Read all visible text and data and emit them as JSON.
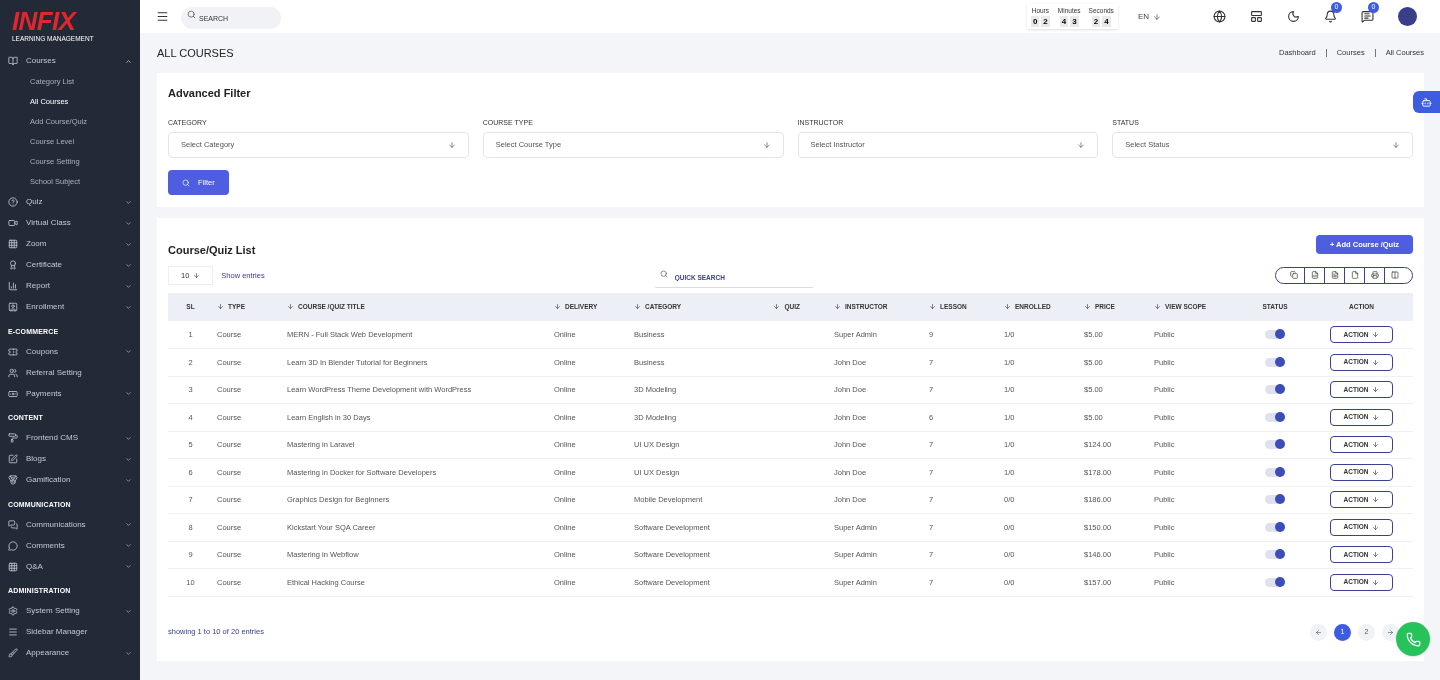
{
  "brand": {
    "logo": "INFIX",
    "tagline": "LEARNING MANAGEMENT"
  },
  "sidebar": {
    "sections": [
      {
        "items": [
          {
            "label": "Courses",
            "expanded": true,
            "children": [
              {
                "label": "Category List",
                "selected": false
              },
              {
                "label": "All Courses",
                "selected": true
              },
              {
                "label": "Add Course/Quiz",
                "selected": false
              },
              {
                "label": "Course Level",
                "selected": false
              },
              {
                "label": "Course Setting",
                "selected": false
              },
              {
                "label": "School Subject",
                "selected": false
              }
            ]
          },
          {
            "label": "Quiz",
            "expanded": false
          },
          {
            "label": "Virtual Class",
            "expanded": false
          },
          {
            "label": "Zoom",
            "expanded": false
          },
          {
            "label": "Certificate",
            "expanded": false
          },
          {
            "label": "Report",
            "expanded": false
          },
          {
            "label": "Enrollment",
            "expanded": false
          }
        ]
      },
      {
        "title": "E-COMMERCE",
        "items": [
          {
            "label": "Coupons",
            "expanded": false
          },
          {
            "label": "Referral Setting"
          },
          {
            "label": "Payments",
            "expanded": false
          }
        ]
      },
      {
        "title": "CONTENT",
        "items": [
          {
            "label": "Frontend CMS",
            "expanded": false
          },
          {
            "label": "Blogs",
            "expanded": false
          },
          {
            "label": "Gamification",
            "expanded": false
          }
        ]
      },
      {
        "title": "COMMUNICATION",
        "items": [
          {
            "label": "Communications",
            "expanded": false
          },
          {
            "label": "Comments",
            "expanded": false
          },
          {
            "label": "Q&A",
            "expanded": false
          }
        ]
      },
      {
        "title": "ADMINISTRATION",
        "items": [
          {
            "label": "System Setting",
            "expanded": false
          },
          {
            "label": "Sidebar Manager"
          },
          {
            "label": "Appearance",
            "expanded": false
          }
        ]
      }
    ]
  },
  "topbar": {
    "search": {
      "placeholder": "SEARCH"
    },
    "timer": [
      {
        "label": "Hours",
        "digits": [
          "0",
          "2"
        ]
      },
      {
        "label": "Minutes",
        "digits": [
          "4",
          "3"
        ]
      },
      {
        "label": "Seconds",
        "digits": [
          "2",
          "4"
        ]
      }
    ],
    "language": "EN",
    "notifications": "0",
    "messages": "0"
  },
  "page": {
    "title": "ALL COURSES",
    "breadcrumb": [
      "Dashboard",
      "Courses",
      "All Courses"
    ]
  },
  "filter": {
    "title": "Advanced Filter",
    "fields": [
      {
        "label": "CATEGORY",
        "placeholder": "Select Category"
      },
      {
        "label": "COURSE TYPE",
        "placeholder": "Select Course Type"
      },
      {
        "label": "INSTRUCTOR",
        "placeholder": "Select Instructor"
      },
      {
        "label": "STATUS",
        "placeholder": "Select Status"
      }
    ],
    "button": "Filter"
  },
  "list": {
    "title": "Course/Quiz List",
    "add_button": "+ Add Course /Quiz",
    "page_size": "10",
    "show_entries": "Show entries",
    "quick_search": {
      "placeholder": "QUICK SEARCH"
    },
    "columns": [
      {
        "label": "SL",
        "sortable": false
      },
      {
        "label": "TYPE",
        "sortable": true
      },
      {
        "label": "COURSE /QUIZ TITLE",
        "sortable": true
      },
      {
        "label": "DELIVERY",
        "sortable": true
      },
      {
        "label": "CATEGORY",
        "sortable": true
      },
      {
        "label": "QUIZ",
        "sortable": true
      },
      {
        "label": "INSTRUCTOR",
        "sortable": true
      },
      {
        "label": "LESSON",
        "sortable": true
      },
      {
        "label": "ENROLLED",
        "sortable": true
      },
      {
        "label": "PRICE",
        "sortable": true
      },
      {
        "label": "VIEW SCOPE",
        "sortable": true
      },
      {
        "label": "STATUS",
        "sortable": false
      },
      {
        "label": "ACTION",
        "sortable": false
      }
    ],
    "rows": [
      {
        "sl": "1",
        "type": "Course",
        "title": "MERN - Full Stack Web Development",
        "delivery": "Online",
        "category": "Business",
        "instructor": "Super Admin",
        "lesson": "9",
        "enrolled": "1/0",
        "price": "$5.00",
        "scope": "Public",
        "status": true,
        "action": "ACTION"
      },
      {
        "sl": "2",
        "type": "Course",
        "title": "Learn 3D In Blender Tutorial for Beginners",
        "delivery": "Online",
        "category": "Business",
        "instructor": "John Doe",
        "lesson": "7",
        "enrolled": "1/0",
        "price": "$5.00",
        "scope": "Public",
        "status": true,
        "action": "ACTION"
      },
      {
        "sl": "3",
        "type": "Course",
        "title": "Learn WordPress Theme Development with WordPress",
        "delivery": "Online",
        "category": "3D Modeling",
        "instructor": "John Doe",
        "lesson": "7",
        "enrolled": "1/0",
        "price": "$5.00",
        "scope": "Public",
        "status": true,
        "action": "ACTION"
      },
      {
        "sl": "4",
        "type": "Course",
        "title": "Learn English in 30 Days",
        "delivery": "Online",
        "category": "3D Modeling",
        "instructor": "John Doe",
        "lesson": "6",
        "enrolled": "1/0",
        "price": "$5.00",
        "scope": "Public",
        "status": true,
        "action": "ACTION"
      },
      {
        "sl": "5",
        "type": "Course",
        "title": "Mastering in Laravel",
        "delivery": "Online",
        "category": "UI UX Design",
        "instructor": "John Doe",
        "lesson": "7",
        "enrolled": "1/0",
        "price": "$124.00",
        "scope": "Public",
        "status": true,
        "action": "ACTION"
      },
      {
        "sl": "6",
        "type": "Course",
        "title": "Mastering in Docker for Software Developers",
        "delivery": "Online",
        "category": "UI UX Design",
        "instructor": "John Doe",
        "lesson": "7",
        "enrolled": "1/0",
        "price": "$178.00",
        "scope": "Public",
        "status": true,
        "action": "ACTION"
      },
      {
        "sl": "7",
        "type": "Course",
        "title": "Graphics Design for Beginners",
        "delivery": "Online",
        "category": "Mobile Development",
        "instructor": "John Doe",
        "lesson": "7",
        "enrolled": "0/0",
        "price": "$186.00",
        "scope": "Public",
        "status": true,
        "action": "ACTION"
      },
      {
        "sl": "8",
        "type": "Course",
        "title": "Kickstart Your SQA Career",
        "delivery": "Online",
        "category": "Software Development",
        "instructor": "Super Admin",
        "lesson": "7",
        "enrolled": "0/0",
        "price": "$150.00",
        "scope": "Public",
        "status": true,
        "action": "ACTION"
      },
      {
        "sl": "9",
        "type": "Course",
        "title": "Mastering in Webflow",
        "delivery": "Online",
        "category": "Software Development",
        "instructor": "Super Admin",
        "lesson": "7",
        "enrolled": "0/0",
        "price": "$146.00",
        "scope": "Public",
        "status": true,
        "action": "ACTION"
      },
      {
        "sl": "10",
        "type": "Course",
        "title": "Ethical Hacking Course",
        "delivery": "Online",
        "category": "Software Development",
        "instructor": "Super Admin",
        "lesson": "7",
        "enrolled": "0/0",
        "price": "$157.00",
        "scope": "Public",
        "status": true,
        "action": "ACTION"
      }
    ],
    "summary": "showing 1 to 10 of 20 entries",
    "pages": [
      {
        "label": "1",
        "selected": true
      },
      {
        "label": "2",
        "selected": false
      }
    ]
  }
}
